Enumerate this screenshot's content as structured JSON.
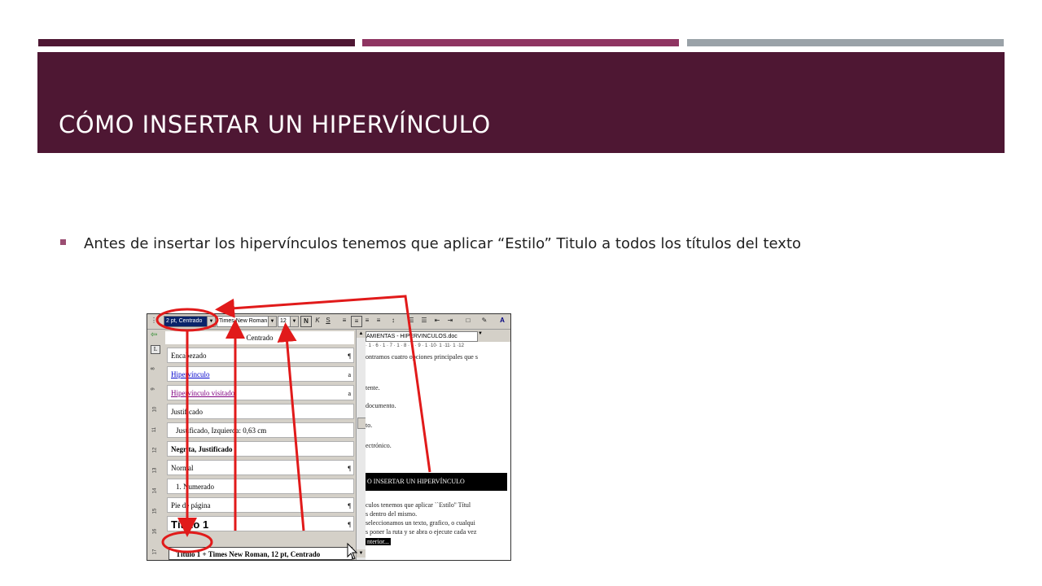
{
  "slide": {
    "title": "CÓMO INSERTAR UN HIPERVÍNCULO",
    "bullet": "Antes de insertar los hipervínculos tenemos que aplicar “Estilo” Titulo a todos los títulos del texto",
    "accent_colors": [
      "#4e1733",
      "#8e3461",
      "#9aa2a8"
    ]
  },
  "word": {
    "toolbar": {
      "style_value": "2 pt, Centrado",
      "font_value": "Times New Roman",
      "size_value": "12",
      "bold_label": "N",
      "italic_label": "K",
      "underline_label": "S"
    },
    "doc_title": "AMIENTAS - HIPERVINCULOS.doc",
    "style_list": {
      "header": "Centrado",
      "items": [
        {
          "label": "Encabezado",
          "mark": "¶"
        },
        {
          "label": "Hipervínculo",
          "mark": "a"
        },
        {
          "label": "Hipervínculo visitado",
          "mark": "a"
        },
        {
          "label": "Justificado",
          "mark": ""
        },
        {
          "label": "Justificado, Izquierda: 0,63 cm",
          "mark": ""
        },
        {
          "label": "Negrita, Justificado",
          "mark": ""
        },
        {
          "label": "Normal",
          "mark": "¶"
        },
        {
          "label": "1.   Numerado",
          "mark": ""
        },
        {
          "label": "Pie de página",
          "mark": "¶"
        },
        {
          "label": "Título 1",
          "mark": "¶"
        }
      ],
      "selected": "Título 1 + Times New Roman, 12 pt, Centrado"
    },
    "ruler_top": "· 1 · 6 · 1 · 7 · 1 · 8 · 1 · 9 · 1 ·10· 1 ·11· 1 ·12",
    "ruler_left": [
      "8",
      "9",
      "10",
      "11",
      "12",
      "13",
      "14",
      "15",
      "16",
      "17"
    ],
    "document_lines": [
      "ontramos cuatro opciones principales que s",
      "tente.",
      "documento.",
      "to.",
      "ectrónico."
    ],
    "doc_heading": "O INSERTAR UN HIPERVÍNCULO",
    "document_lines_after": [
      "culos tenemos que aplicar ``Estilo'' Títul",
      "s dentro del mismo.",
      "seleccionamos un texto, grafico, o cualqui",
      "s poner la ruta y se abra o ejecute cada vez",
      "nterior..."
    ]
  }
}
